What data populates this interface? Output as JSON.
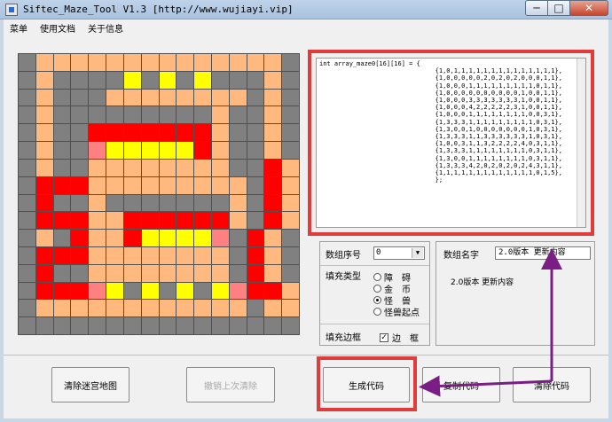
{
  "window": {
    "title": "Siftec_Maze_Tool   V1.3   [http://www.wujiayi.vip]",
    "min_icon": "minimize-icon",
    "max_icon": "maximize-icon",
    "close_icon": "close-icon"
  },
  "menu": {
    "items": [
      "菜单",
      "使用文档",
      "关于信息"
    ]
  },
  "maze": {
    "legend": {
      "0": "#808080",
      "1": "#ffb97f",
      "2": "#ffff00",
      "3": "#ff0000",
      "4": "#ff8080",
      "5": "#ffb97f"
    },
    "rows": [
      [
        0,
        1,
        1,
        1,
        1,
        1,
        1,
        1,
        1,
        1,
        1,
        1,
        1,
        1,
        1,
        0
      ],
      [
        0,
        1,
        0,
        0,
        0,
        0,
        2,
        0,
        2,
        0,
        2,
        0,
        0,
        0,
        1,
        0
      ],
      [
        0,
        1,
        0,
        0,
        0,
        1,
        1,
        1,
        1,
        1,
        1,
        1,
        1,
        0,
        1,
        0
      ],
      [
        0,
        1,
        0,
        0,
        0,
        0,
        0,
        0,
        0,
        0,
        0,
        1,
        0,
        0,
        1,
        0
      ],
      [
        0,
        1,
        0,
        0,
        3,
        3,
        3,
        3,
        3,
        3,
        3,
        1,
        0,
        0,
        1,
        0
      ],
      [
        0,
        1,
        0,
        0,
        4,
        2,
        2,
        2,
        2,
        2,
        3,
        1,
        0,
        0,
        1,
        0
      ],
      [
        0,
        1,
        0,
        0,
        1,
        1,
        1,
        1,
        1,
        1,
        1,
        1,
        0,
        0,
        3,
        1
      ],
      [
        0,
        3,
        3,
        3,
        1,
        1,
        1,
        1,
        1,
        1,
        1,
        1,
        1,
        0,
        3,
        1
      ],
      [
        0,
        3,
        0,
        0,
        1,
        0,
        0,
        0,
        0,
        0,
        0,
        0,
        1,
        0,
        3,
        1
      ],
      [
        0,
        3,
        3,
        3,
        1,
        1,
        3,
        3,
        3,
        3,
        3,
        3,
        1,
        0,
        3,
        1
      ],
      [
        0,
        1,
        0,
        3,
        1,
        1,
        3,
        2,
        2,
        2,
        2,
        4,
        0,
        3,
        1,
        0
      ],
      [
        0,
        3,
        3,
        3,
        1,
        1,
        1,
        1,
        1,
        1,
        1,
        1,
        0,
        3,
        1,
        0
      ],
      [
        0,
        3,
        0,
        0,
        1,
        1,
        1,
        1,
        1,
        1,
        1,
        1,
        0,
        3,
        1,
        0
      ],
      [
        0,
        3,
        3,
        3,
        4,
        2,
        0,
        2,
        0,
        2,
        0,
        2,
        4,
        3,
        3,
        1
      ],
      [
        0,
        1,
        1,
        1,
        1,
        1,
        1,
        1,
        1,
        1,
        1,
        1,
        1,
        0,
        1,
        5
      ],
      [
        0,
        0,
        0,
        0,
        0,
        0,
        0,
        0,
        0,
        0,
        0,
        0,
        0,
        0,
        0,
        0
      ]
    ]
  },
  "code": {
    "text": "int array_maze0[16][16] = {\n                               {1,0,1,1,1,1,1,1,1,1,1,1,1,1,1,1},\n                               {1,0,0,0,0,0,2,0,2,0,2,0,0,0,1,1},\n                               {1,0,0,0,1,1,1,1,1,1,1,1,1,0,1,1},\n                               {1,0,0,0,0,0,0,0,0,0,0,1,0,0,1,1},\n                               {1,0,0,0,3,3,3,3,3,3,3,1,0,0,1,1},\n                               {1,0,0,0,4,2,2,2,2,2,3,1,0,0,1,1},\n                               {1,0,0,0,1,1,1,1,1,1,1,1,0,0,3,1},\n                               {1,3,3,3,1,1,1,1,1,1,1,1,1,0,3,1},\n                               {1,3,0,0,1,0,0,0,0,0,0,0,1,0,3,1},\n                               {1,3,3,3,1,1,3,3,3,3,3,3,1,0,3,1},\n                               {1,0,0,3,1,1,3,2,2,2,2,4,0,3,1,1},\n                               {1,3,3,3,1,1,1,1,1,1,1,1,0,3,1,1},\n                               {1,3,0,0,1,1,1,1,1,1,1,1,0,3,1,1},\n                               {1,3,3,3,4,2,0,2,0,2,0,2,4,3,1,1},\n                               {1,1,1,1,1,1,1,1,1,1,1,1,1,0,1,5},\n                               };"
  },
  "array_index": {
    "label": "数组序号",
    "value": "0"
  },
  "fill_type": {
    "label": "填充类型",
    "options": [
      {
        "label": "障　碍",
        "checked": false
      },
      {
        "label": "金　币",
        "checked": false
      },
      {
        "label": "怪　兽",
        "checked": true
      },
      {
        "label": "怪兽起点",
        "checked": false
      }
    ]
  },
  "fill_border": {
    "label": "填充边框",
    "checkbox_label": "边　框",
    "checked": true
  },
  "array_name": {
    "label": "数组名字",
    "value": "2.0版本 更新内容",
    "description": "2.0版本 更新内容"
  },
  "buttons": {
    "clear_map": "清除迷宫地图",
    "undo_clear": "撤销上次清除",
    "generate_code": "生成代码",
    "copy_code": "复制代码",
    "clear_code": "清除代码"
  },
  "highlight_color": "#e03c3c",
  "arrow_color": "#7a1e86"
}
